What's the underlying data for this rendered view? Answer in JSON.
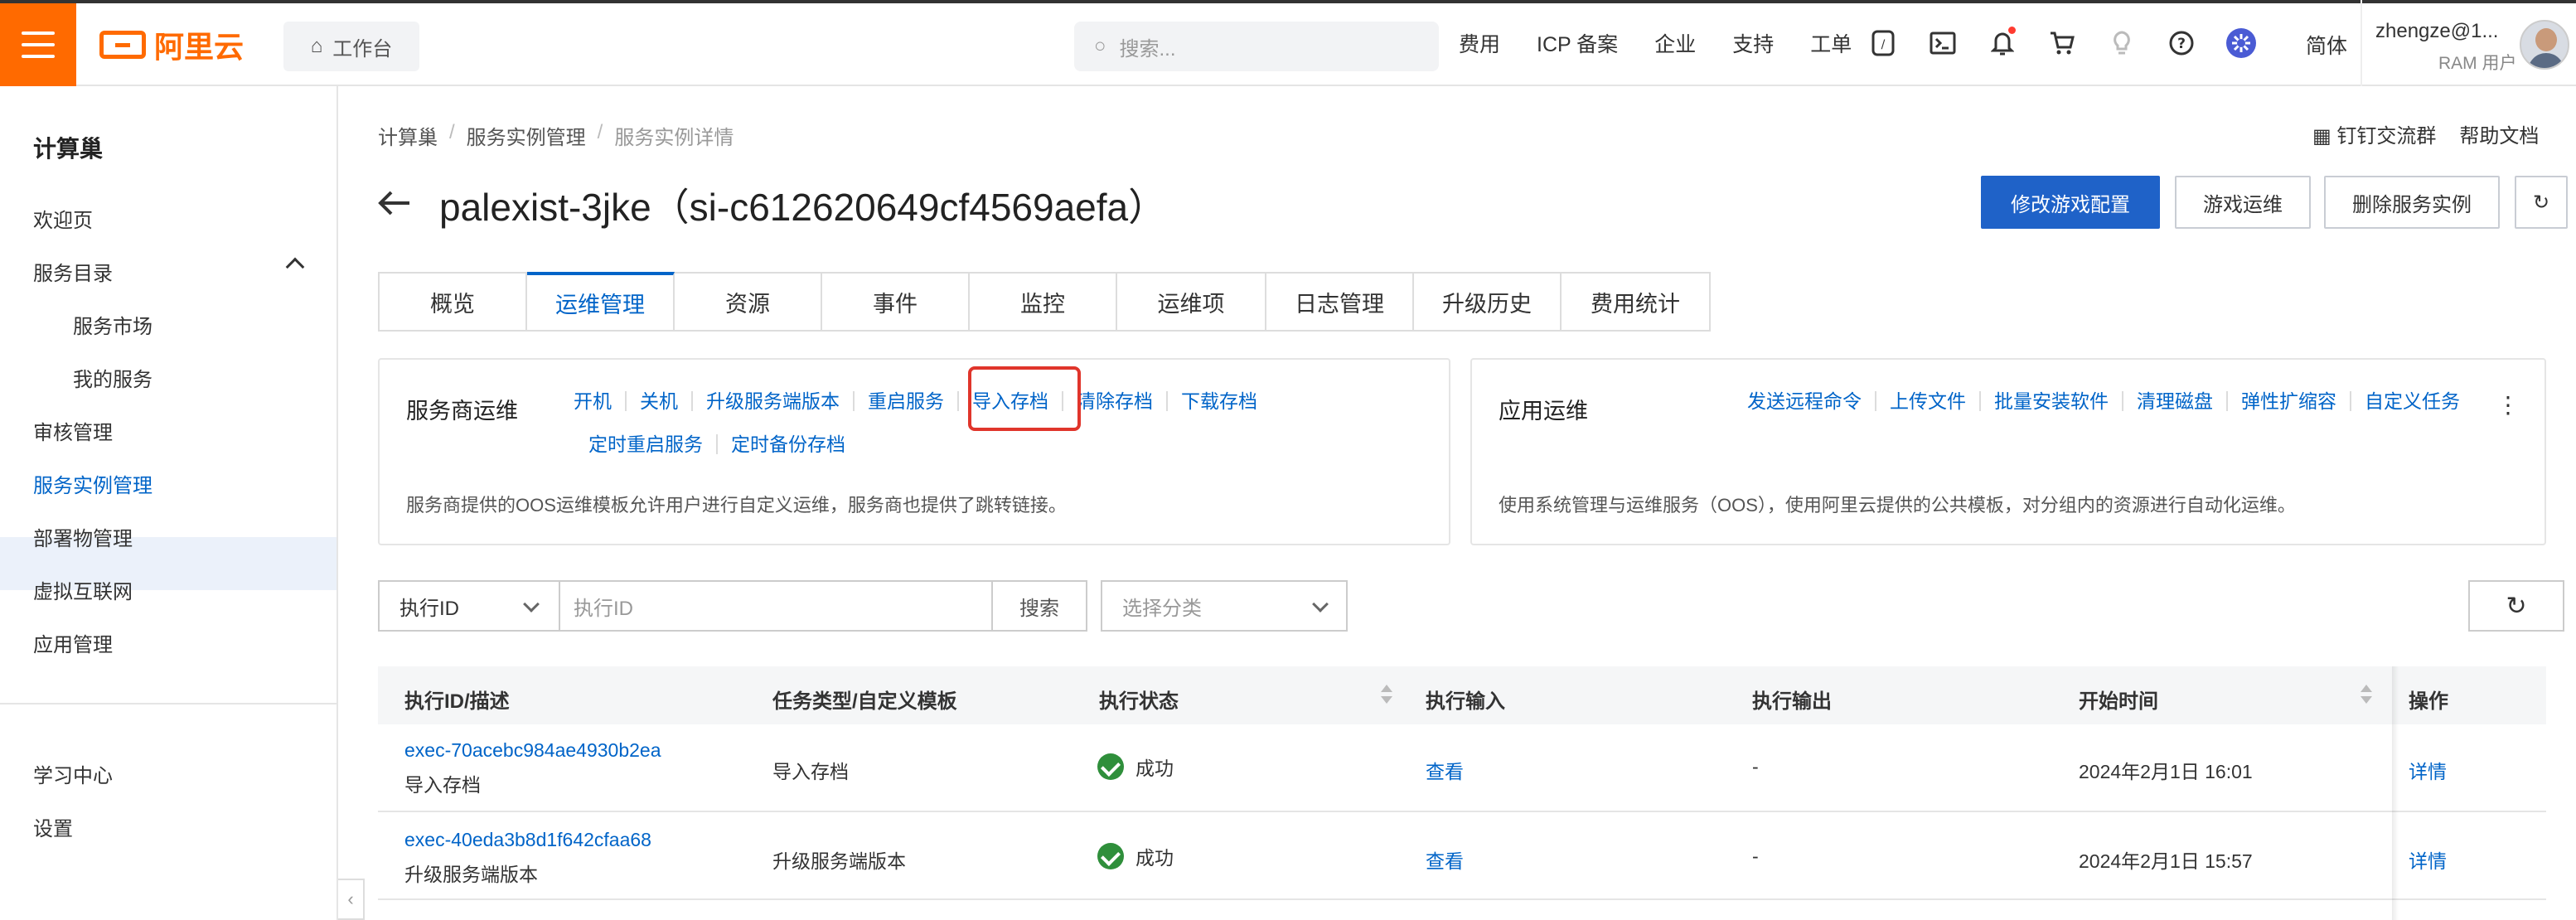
{
  "brand": {
    "name": "阿里云",
    "accent": "#ff6a00",
    "link_color": "#0064c8"
  },
  "topbar": {
    "workbench_label": "工作台",
    "search_placeholder": "搜索...",
    "nav": [
      "费用",
      "ICP 备案",
      "企业",
      "支持",
      "工单"
    ],
    "language": "简体",
    "user_name": "zhengze@1...",
    "user_role": "RAM 用户"
  },
  "sidebar": {
    "title": "计算巢",
    "items": [
      "欢迎页",
      "服务目录",
      "服务市场",
      "我的服务",
      "审核管理",
      "服务实例管理",
      "部署物管理",
      "虚拟互联网",
      "应用管理"
    ],
    "bottom_items": [
      "学习中心",
      "设置"
    ],
    "active_item": "服务实例管理"
  },
  "breadcrumb": [
    "计算巢",
    "服务实例管理",
    "服务实例详情"
  ],
  "header_links": [
    "钉钉交流群",
    "帮助文档"
  ],
  "page": {
    "title": "palexist-3jke（si-c612620649cf4569aefa）",
    "buttons": {
      "primary": "修改游戏配置",
      "game_ops": "游戏运维",
      "delete": "删除服务实例"
    }
  },
  "tabs": [
    "概览",
    "运维管理",
    "资源",
    "事件",
    "监控",
    "运维项",
    "日志管理",
    "升级历史",
    "费用统计"
  ],
  "active_tab": "运维管理",
  "provider_ops": {
    "title": "服务商运维",
    "actions_row1": [
      "开机",
      "关机",
      "升级服务端版本",
      "重启服务",
      "导入存档",
      "清除存档",
      "下载存档"
    ],
    "actions_row2": [
      "定时重启服务",
      "定时备份存档"
    ],
    "highlighted_action": "导入存档",
    "description": "服务商提供的OOS运维模板允许用户进行自定义运维，服务商也提供了跳转链接。"
  },
  "app_ops": {
    "title": "应用运维",
    "actions": [
      "发送远程命令",
      "上传文件",
      "批量安装软件",
      "清理磁盘",
      "弹性扩缩容",
      "自定义任务"
    ],
    "description": "使用系统管理与运维服务（OOS），使用阿里云提供的公共模板，对分组内的资源进行自动化运维。"
  },
  "filter": {
    "field_select": "执行ID",
    "input_placeholder": "执行ID",
    "search_label": "搜索",
    "category_placeholder": "选择分类"
  },
  "table": {
    "columns": [
      "执行ID/描述",
      "任务类型/自定义模板",
      "执行状态",
      "执行输入",
      "执行输出",
      "开始时间",
      "操作"
    ],
    "rows": [
      {
        "id": "exec-70acebc984ae4930b2ea",
        "desc": "导入存档",
        "type": "导入存档",
        "status": "成功",
        "input": "查看",
        "output": "-",
        "start": "2024年2月1日 16:01",
        "action": "详情"
      },
      {
        "id": "exec-40eda3b8d1f642cfaa68",
        "desc": "升级服务端版本",
        "type": "升级服务端版本",
        "status": "成功",
        "input": "查看",
        "output": "-",
        "start": "2024年2月1日 15:57",
        "action": "详情"
      }
    ]
  },
  "icons": [
    "menu-icon",
    "home-icon",
    "search-icon",
    "code-icon",
    "terminal-icon",
    "bell-icon",
    "cart-icon",
    "bulb-icon",
    "help-icon",
    "apps-icon",
    "qrcode-icon",
    "refresh-icon",
    "back-arrow-icon",
    "check-icon"
  ]
}
